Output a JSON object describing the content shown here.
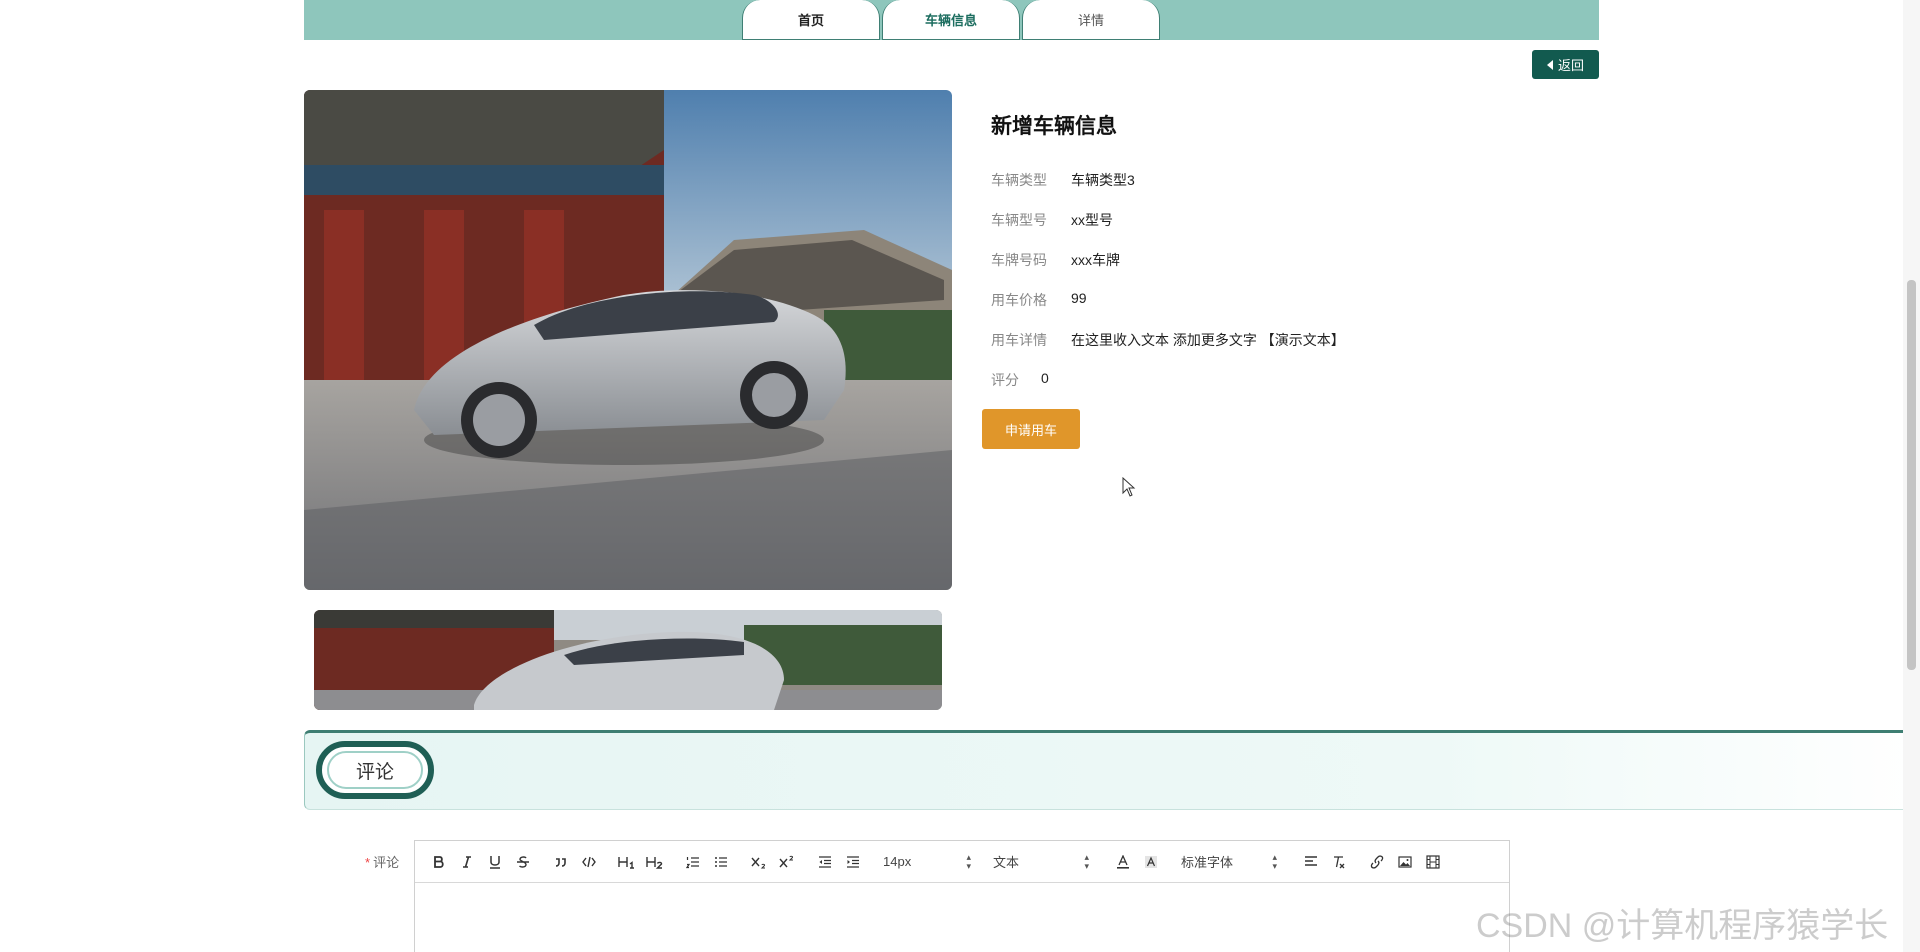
{
  "tabs": [
    {
      "label": "首页"
    },
    {
      "label": "车辆信息"
    },
    {
      "label": "详情"
    }
  ],
  "back_label": "返回",
  "detail": {
    "title": "新增车辆信息",
    "rows": [
      {
        "label": "车辆类型",
        "value": "车辆类型3"
      },
      {
        "label": "车辆型号",
        "value": "xx型号"
      },
      {
        "label": "车牌号码",
        "value": "xxx车牌"
      },
      {
        "label": "用车价格",
        "value": "99"
      },
      {
        "label": "用车详情",
        "value": "在这里收入文本 添加更多文字 【演示文本】"
      }
    ],
    "score_label": "评分",
    "score_value": "0",
    "apply_label": "申请用车"
  },
  "comment": {
    "section_label": "评论",
    "field_label": "评论",
    "required_mark": "*"
  },
  "editor_toolbar": {
    "font_size": "14px",
    "header_select": "文本",
    "font_family": "标准字体"
  },
  "watermark": "CSDN @计算机程序猿学长",
  "colors": {
    "band": "#8ec6bc",
    "accent": "#125a4f",
    "apply": "#e0962a"
  },
  "icons": [
    "bold-icon",
    "italic-icon",
    "underline-icon",
    "strike-icon",
    "blockquote-icon",
    "code-icon",
    "h1-icon",
    "h2-icon",
    "ordered-list-icon",
    "bullet-list-icon",
    "subscript-icon",
    "superscript-icon",
    "outdent-icon",
    "indent-icon",
    "font-color-icon",
    "background-color-icon",
    "align-icon",
    "clear-format-icon",
    "link-icon",
    "image-icon",
    "video-icon"
  ]
}
